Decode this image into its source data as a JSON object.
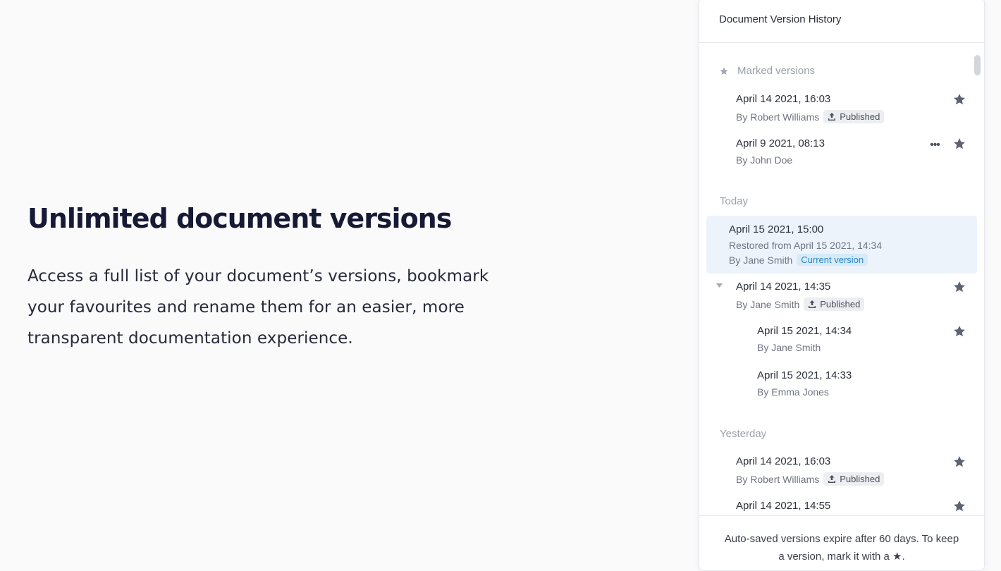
{
  "hero": {
    "title": "Unlimited document versions",
    "body": "Access a full list of your document’s versions, bookmark your favourites and rename them for an easier, more transparent documentation experience."
  },
  "panel": {
    "title": "Document Version History",
    "groups": {
      "marked": "Marked versions",
      "today": "Today",
      "yesterday": "Yesterday"
    },
    "entries": [
      {
        "date": "April 14 2021, 16:03",
        "author": "By Robert Williams",
        "badge": "Published"
      },
      {
        "date": "April 9 2021, 08:13",
        "author": "By John Doe"
      },
      {
        "date": "April 15 2021, 15:00",
        "restored": "Restored from April 15 2021, 14:34",
        "author": "By Jane Smith",
        "badge": "Current version"
      },
      {
        "date": "April 14 2021, 14:35",
        "author": "By Jane Smith",
        "badge": "Published"
      },
      {
        "date": "April 15 2021, 14:34",
        "author": "By Jane Smith"
      },
      {
        "date": "April 15 2021, 14:33",
        "author": "By Emma Jones"
      },
      {
        "date": "April 14 2021, 16:03",
        "author": "By Robert Williams",
        "badge": "Published"
      },
      {
        "date": "April 14 2021, 14:55"
      }
    ],
    "footer": "Auto-saved versions expire after 60 days. To keep a version, mark it with a ★."
  },
  "colors": {
    "accent_bg": "#edf3fb",
    "current_badge": "#2a86c9",
    "star": "#5b6370"
  }
}
